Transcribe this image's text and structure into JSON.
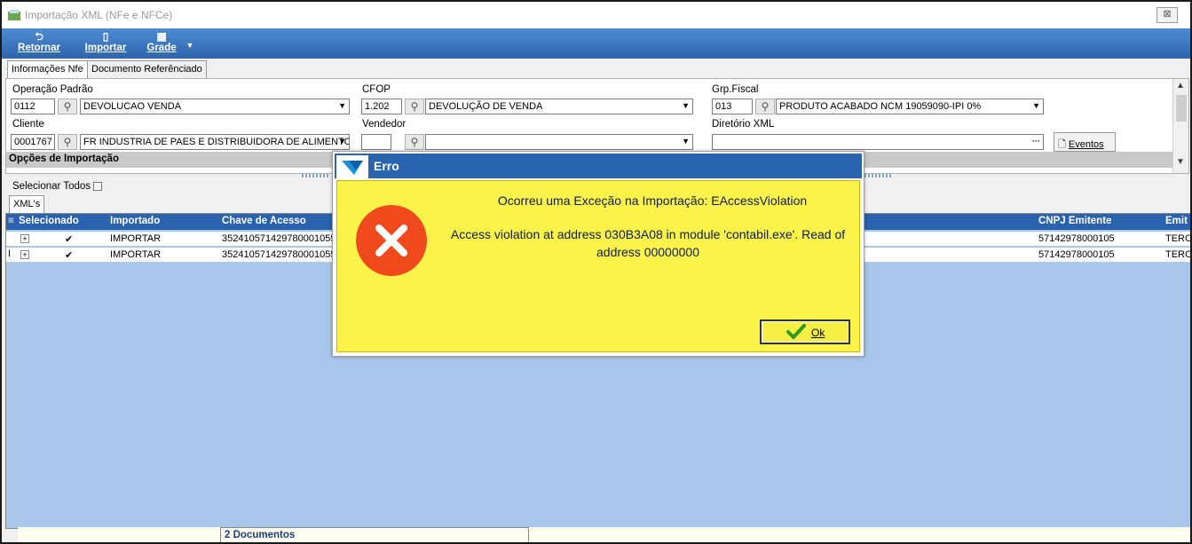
{
  "window": {
    "title": "Importação XML (NFe e NFCe)",
    "close_label": "⊠"
  },
  "toolbar": {
    "retornar": "Retornar",
    "importar": "Importar",
    "grade": "Grade"
  },
  "tabs": [
    "Informações Nfe",
    "Documento Referênciado"
  ],
  "form": {
    "operacao_label": "Operação Padrão",
    "operacao_code": "0112",
    "operacao_value": "DEVOLUCAO VENDA",
    "cfop_label": "CFOP",
    "cfop_code": "1.202",
    "cfop_value": "DEVOLUÇÃO DE VENDA",
    "grp_fiscal_label": "Grp.Fiscal",
    "grp_fiscal_code": "013",
    "grp_fiscal_value": "PRODUTO ACABADO NCM 19059090-IPI 0%",
    "cliente_label": "Cliente",
    "cliente_code": "0001767",
    "cliente_value": "FR INDUSTRIA DE PAES E DISTRIBUIDORA DE ALIMENTOS",
    "vendedor_label": "Vendedor",
    "vendedor_code": "",
    "vendedor_value": "",
    "diretorio_label": "Diretório XML",
    "diretorio_value": "",
    "diretorio_btn": "···",
    "eventos_btn": "Eventos",
    "section_title": "Opções de Importação"
  },
  "select_all_label": "Selecionar Todos",
  "grid_tab": "XML's",
  "grid": {
    "columns": [
      "Selecionado",
      "Importado",
      "Chave de Acesso",
      "CNPJ Emitente",
      "Emit"
    ],
    "rows": [
      {
        "selected": "✔",
        "importado": "IMPORTAR",
        "chave": "352410571429780001055",
        "cnpj": "57142978000105",
        "emit": "TERC"
      },
      {
        "selected": "✔",
        "importado": "IMPORTAR",
        "chave": "352410571429780001055",
        "cnpj": "57142978000105",
        "emit": "TERC"
      }
    ]
  },
  "footer": {
    "count": "2 Documentos"
  },
  "dialog": {
    "title": "Erro",
    "message1": "Ocorreu uma Exceção na Importação: EAccessViolation",
    "message2": "Access violation at address 030B3A08 in module 'contabil.exe'. Read of address 00000000",
    "ok_label": "Ok"
  },
  "colors": {
    "toolbar": "#2e65ae",
    "grid_bg": "#a8c5ea",
    "dialog_body": "#fbf24a",
    "dialog_title": "#2a63b0",
    "error_icon": "#f04a1c"
  },
  "icons": [
    "retornar-icon",
    "importar-icon",
    "grade-icon",
    "search-icon",
    "error-icon",
    "check-icon",
    "app-logo-icon"
  ]
}
